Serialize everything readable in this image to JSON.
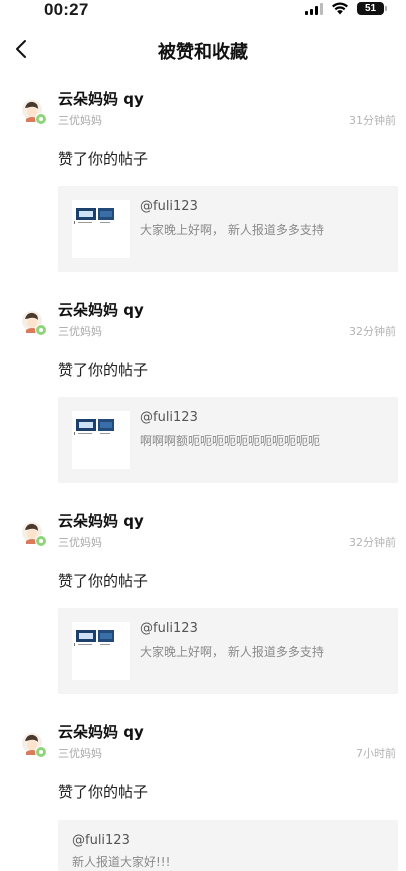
{
  "status": {
    "time": "00:27",
    "battery": "51"
  },
  "header": {
    "title": "被赞和收藏"
  },
  "notifications": [
    {
      "user": "云朵妈妈 qy",
      "tag": "三优妈妈",
      "time": "31分钟前",
      "action": "赞了你的帖子",
      "post_handle": "@fuli123",
      "post_text": "大家晚上好啊， 新人报道多多支持"
    },
    {
      "user": "云朵妈妈 qy",
      "tag": "三优妈妈",
      "time": "32分钟前",
      "action": "赞了你的帖子",
      "post_handle": "@fuli123",
      "post_text": "啊啊啊额呃呃呃呃呃呃呃呃呃呃呃"
    },
    {
      "user": "云朵妈妈 qy",
      "tag": "三优妈妈",
      "time": "32分钟前",
      "action": "赞了你的帖子",
      "post_handle": "@fuli123",
      "post_text": "大家晚上好啊， 新人报道多多支持"
    },
    {
      "user": "云朵妈妈 qy",
      "tag": "三优妈妈",
      "time": "7小时前",
      "action": "赞了你的帖子",
      "post_handle": "@fuli123",
      "post_text": "新人报道大家好!!!"
    }
  ]
}
